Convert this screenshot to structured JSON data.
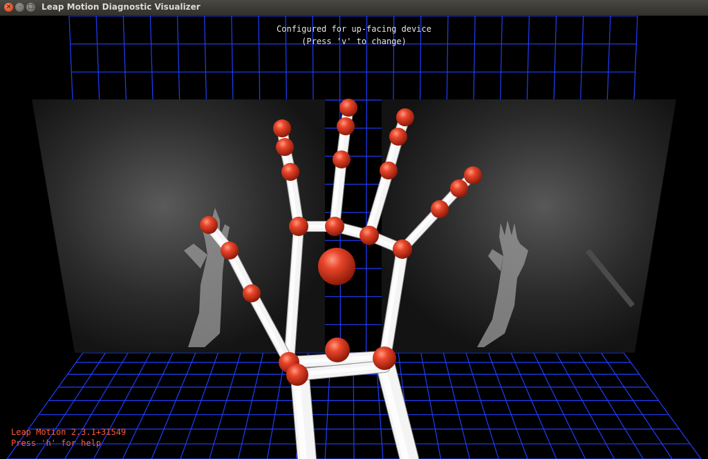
{
  "window": {
    "title": "Leap Motion Diagnostic Visualizer",
    "close_glyph": "×",
    "minimize_glyph": "–",
    "maximize_glyph": "□"
  },
  "overlay": {
    "orientation_line": "Configured for up-facing device",
    "orientation_hint": "(Press 'v' to change)",
    "version": "Leap Motion 2.3.1+31549",
    "help": "Press 'h' for help"
  },
  "colors": {
    "grid": "#1f3fff",
    "joint": "#d8331e",
    "bone": "#f2f2f2",
    "overlay_text": "#e6e6e6",
    "status_text": "#ff5a3a"
  },
  "icons": {
    "close": "close-icon",
    "minimize": "minimize-icon",
    "maximize": "maximize-icon"
  }
}
